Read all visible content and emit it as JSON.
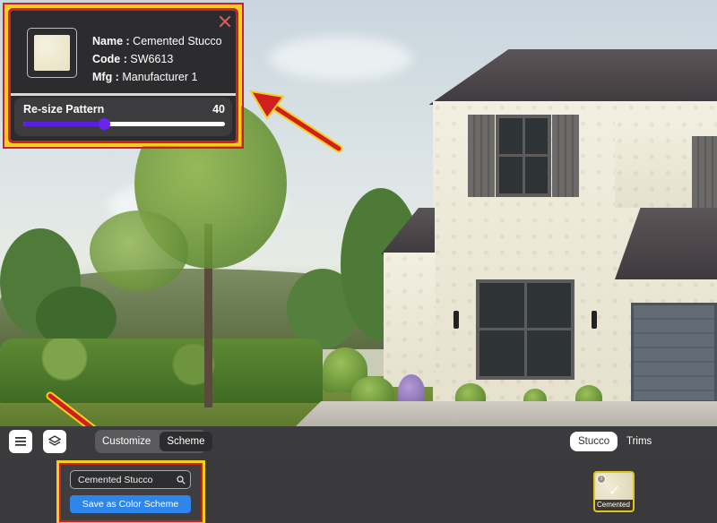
{
  "material_info": {
    "name_label": "Name :",
    "name_value": "Cemented Stucco",
    "code_label": "Code :",
    "code_value": "SW6613",
    "mfg_label": "Mfg :",
    "mfg_value": "Manufacturer 1",
    "swatch_color": "#efe9cf"
  },
  "resize_pattern": {
    "label": "Re-size Pattern",
    "value": "40",
    "level_percent": 40
  },
  "toolbar": {
    "view_tabs": [
      "Customize",
      "Scheme"
    ],
    "category_tabs": [
      "Stucco",
      "Trims"
    ],
    "active_category": "Stucco"
  },
  "bottom": {
    "search_value": "Cemented Stucco",
    "save_label": "Save as Color Scheme",
    "thumb_label": "Cemented ..."
  },
  "colors": {
    "accent_blue": "#2f86ea",
    "slider_purple": "#5a1fe0",
    "highlight_red": "#d11f1f",
    "highlight_yellow": "#f3cf1d",
    "selected_border": "#e4c21f"
  }
}
